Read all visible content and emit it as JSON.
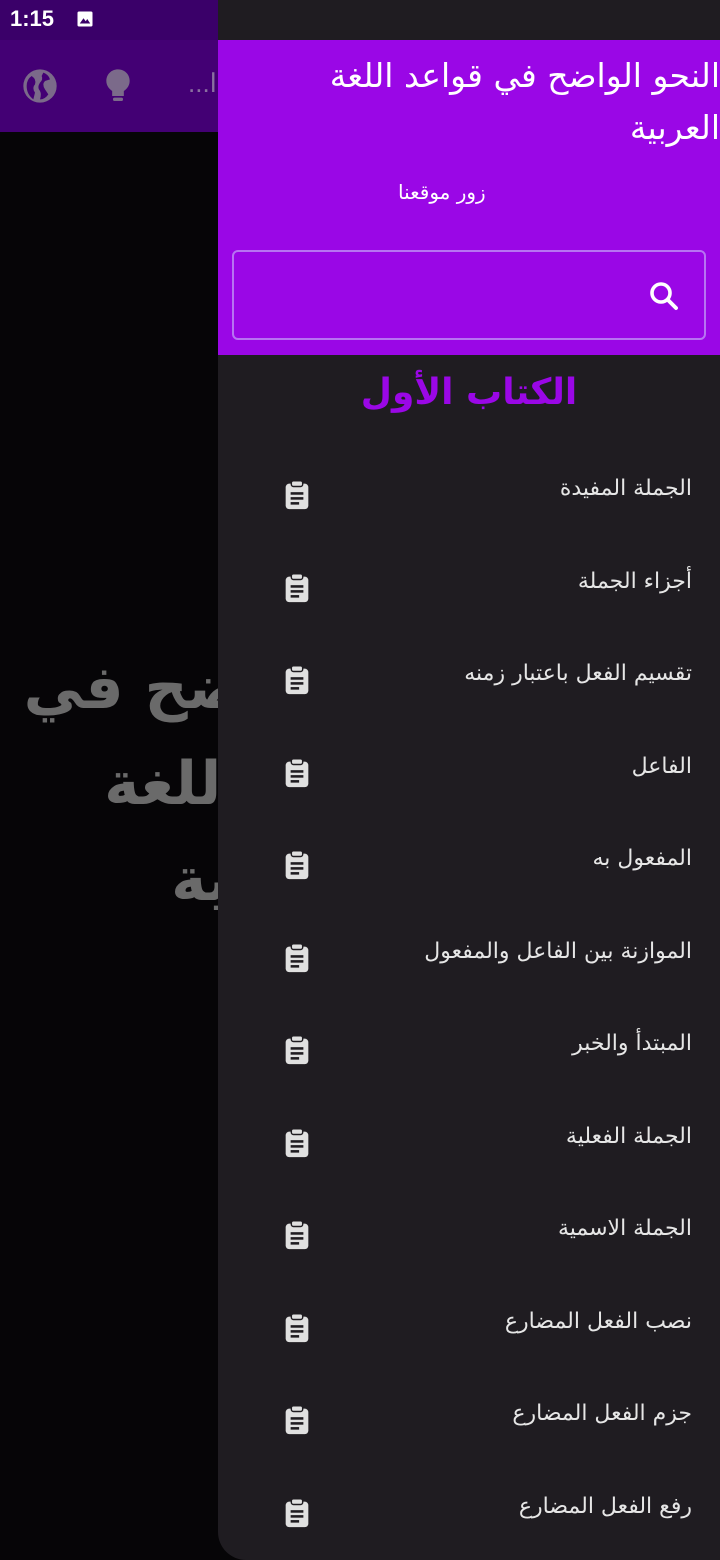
{
  "status_bar": {
    "time": "1:15",
    "icons": [
      "image-icon"
    ]
  },
  "app_bar": {
    "actions": [
      "globe-icon",
      "lightbulb-icon"
    ],
    "overflow_text": "...ا"
  },
  "main": {
    "title_line1": "النحو الواضح في",
    "title_line2": "قواعد اللغة العربية"
  },
  "drawer": {
    "header_title": "النحو الواضح في قواعد اللغة العربية",
    "header_link": "زور موقعنا",
    "search": {
      "placeholder": "",
      "value": ""
    },
    "section_title": "الكتاب الأول",
    "items": [
      {
        "label": "الجملة المفيدة",
        "icon": "clipboard-icon"
      },
      {
        "label": "أجزاء الجملة",
        "icon": "clipboard-icon"
      },
      {
        "label": "تقسيم الفعل باعتبار زمنه",
        "icon": "clipboard-icon"
      },
      {
        "label": "الفاعل",
        "icon": "clipboard-icon"
      },
      {
        "label": "المفعول به",
        "icon": "clipboard-icon"
      },
      {
        "label": "الموازنة بين الفاعل والمفعول",
        "icon": "clipboard-icon"
      },
      {
        "label": "المبتدأ والخبر",
        "icon": "clipboard-icon"
      },
      {
        "label": "الجملة الفعلية",
        "icon": "clipboard-icon"
      },
      {
        "label": "الجملة الاسمية",
        "icon": "clipboard-icon"
      },
      {
        "label": "نصب الفعل المضارع",
        "icon": "clipboard-icon"
      },
      {
        "label": "جزم الفعل المضارع",
        "icon": "clipboard-icon"
      },
      {
        "label": "رفع الفعل المضارع",
        "icon": "clipboard-icon"
      }
    ]
  },
  "colors": {
    "accent": "#9a07e6",
    "drawer_bg": "#1f1c21",
    "app_bar_dimmed": "#430074"
  }
}
